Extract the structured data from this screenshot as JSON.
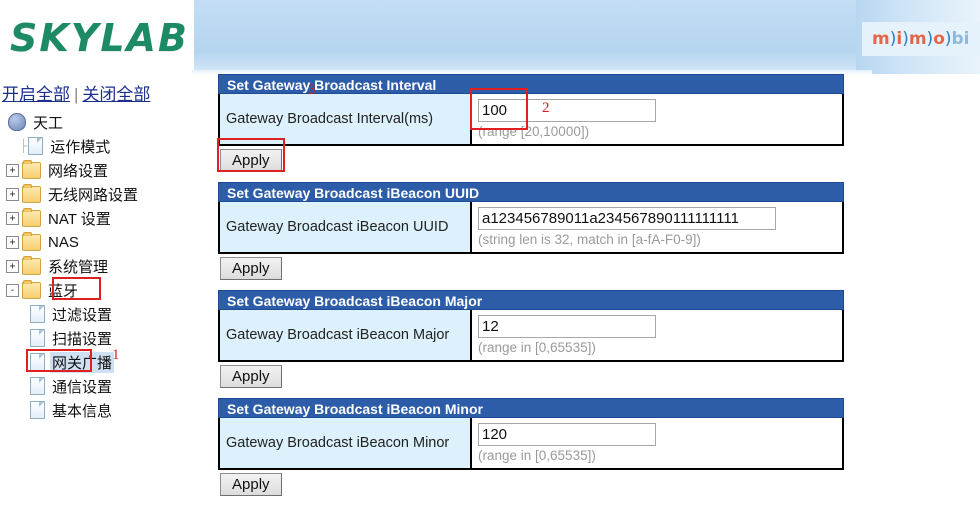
{
  "header": {
    "logo_text": "SKYLAB",
    "mimo_logo": {
      "m1": "m",
      "p1": ")",
      "i": "i",
      "p2": ")",
      "m2": "m",
      "p3": ")",
      "o": "o",
      "p4": ")",
      "bi": "bi"
    },
    "colors": {
      "brand_green": "#1d8a66",
      "section_blue": "#2d5ca8",
      "label_cyan": "#dcf1fb",
      "annotation_red": "#e02020"
    }
  },
  "toolbar": {
    "expand_all": "开启全部",
    "separator": "|",
    "collapse_all": "关闭全部"
  },
  "sidebar": {
    "root": {
      "label": "天工",
      "icon": "computer-icon"
    },
    "items": [
      {
        "label": "运作模式",
        "icon": "page-icon",
        "expander": "",
        "level": 1
      },
      {
        "label": "网络设置",
        "icon": "folder-icon",
        "expander": "+",
        "level": 1
      },
      {
        "label": "无线网路设置",
        "icon": "folder-icon",
        "expander": "+",
        "level": 1
      },
      {
        "label": "NAT 设置",
        "icon": "folder-icon",
        "expander": "+",
        "level": 1
      },
      {
        "label": "NAS",
        "icon": "folder-icon",
        "expander": "+",
        "level": 1
      },
      {
        "label": "系统管理",
        "icon": "folder-icon",
        "expander": "+",
        "level": 1
      },
      {
        "label": "蓝牙",
        "icon": "folder-icon",
        "expander": "-",
        "level": 1,
        "highlighted_box": true
      },
      {
        "label": "过滤设置",
        "icon": "page-icon",
        "expander": "",
        "level": 2
      },
      {
        "label": "扫描设置",
        "icon": "page-icon",
        "expander": "",
        "level": 2
      },
      {
        "label": "网关广播",
        "icon": "page-icon",
        "expander": "",
        "level": 2,
        "selected": true,
        "highlighted_box": true
      },
      {
        "label": "通信设置",
        "icon": "page-icon",
        "expander": "",
        "level": 2
      },
      {
        "label": "基本信息",
        "icon": "page-icon",
        "expander": "",
        "level": 2
      }
    ]
  },
  "annotations": [
    {
      "number": "1",
      "target": "sidebar-item-gateway-broadcast"
    },
    {
      "number": "2",
      "target": "interval-input"
    },
    {
      "number": "3",
      "target": "interval-apply-button"
    }
  ],
  "main": {
    "sections": [
      {
        "title": "Set Gateway Broadcast Interval",
        "label": "Gateway Broadcast Interval(ms)",
        "value": "100",
        "placeholder": "",
        "hint": "(range [20,10000])",
        "apply_label": "Apply",
        "input_size": "short"
      },
      {
        "title": "Set Gateway Broadcast iBeacon UUID",
        "label": "Gateway Broadcast iBeacon UUID",
        "value": "a123456789011a234567890111111111",
        "placeholder": "",
        "hint": "(string len is 32, match in [a-fA-F0-9])",
        "apply_label": "Apply",
        "input_size": "long"
      },
      {
        "title": "Set Gateway Broadcast iBeacon Major",
        "label": "Gateway Broadcast iBeacon Major",
        "value": "12",
        "placeholder": "",
        "hint": "(range in [0,65535])",
        "apply_label": "Apply",
        "input_size": "short"
      },
      {
        "title": "Set Gateway Broadcast iBeacon Minor",
        "label": "Gateway Broadcast iBeacon Minor",
        "value": "120",
        "placeholder": "",
        "hint": "(range in [0,65535])",
        "apply_label": "Apply",
        "input_size": "short"
      }
    ]
  }
}
